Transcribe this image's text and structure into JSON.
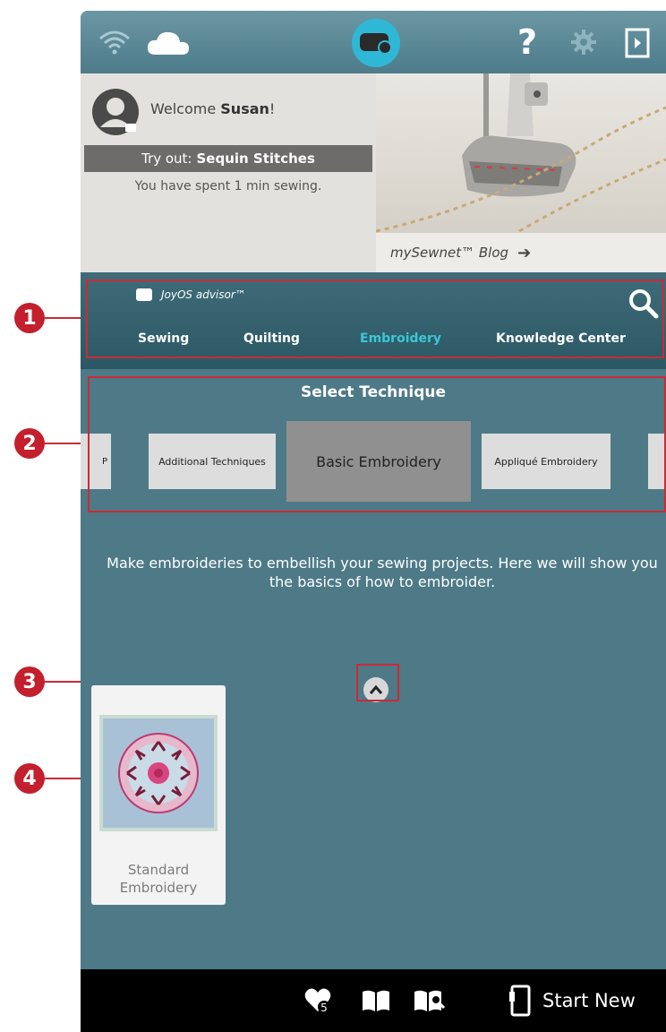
{
  "welcome": {
    "greeting": "Welcome",
    "user_name": "Susan",
    "exclamation": "!",
    "tryout_prefix": "Try out:",
    "tryout_item": "Sequin Stitches",
    "time_spent": "You have spent 1 min sewing."
  },
  "blog": {
    "caption": "mySewnet™ Blog",
    "arrow": "➔"
  },
  "advisor": {
    "logo_text": "JoyOS advisor™",
    "nav": [
      {
        "label": "Sewing",
        "active": false
      },
      {
        "label": "Quilting",
        "active": false
      },
      {
        "label": "Embroidery",
        "active": true
      },
      {
        "label": "Knowledge Center",
        "active": false
      }
    ]
  },
  "technique": {
    "title": "Select Technique",
    "items": [
      {
        "label": "P",
        "selected": false
      },
      {
        "label": "Additional Techniques",
        "selected": false
      },
      {
        "label": "Basic Embroidery",
        "selected": true
      },
      {
        "label": "Appliqué Embroidery",
        "selected": false
      },
      {
        "label": "",
        "selected": false
      }
    ],
    "description": "Make embroideries to embellish your sewing projects. Here we will show you the basics of how to embroider."
  },
  "project_card": {
    "label": "Standard Embroidery"
  },
  "bottombar": {
    "start_new": "Start New",
    "favorites_count": "5"
  },
  "callouts": [
    "1",
    "2",
    "3",
    "4"
  ],
  "colors": {
    "background": "#4e7a87",
    "active_nav": "#3cc6d8",
    "callout": "#c31f2c",
    "machine_button": "#2fb8d6"
  },
  "icons": [
    "wifi-icon",
    "cloud-icon",
    "machine-icon",
    "help-icon",
    "gear-icon",
    "exit-icon",
    "search-icon",
    "chevron-up-icon",
    "favorites-icon",
    "book-icon",
    "book-search-icon",
    "start-new-icon"
  ]
}
